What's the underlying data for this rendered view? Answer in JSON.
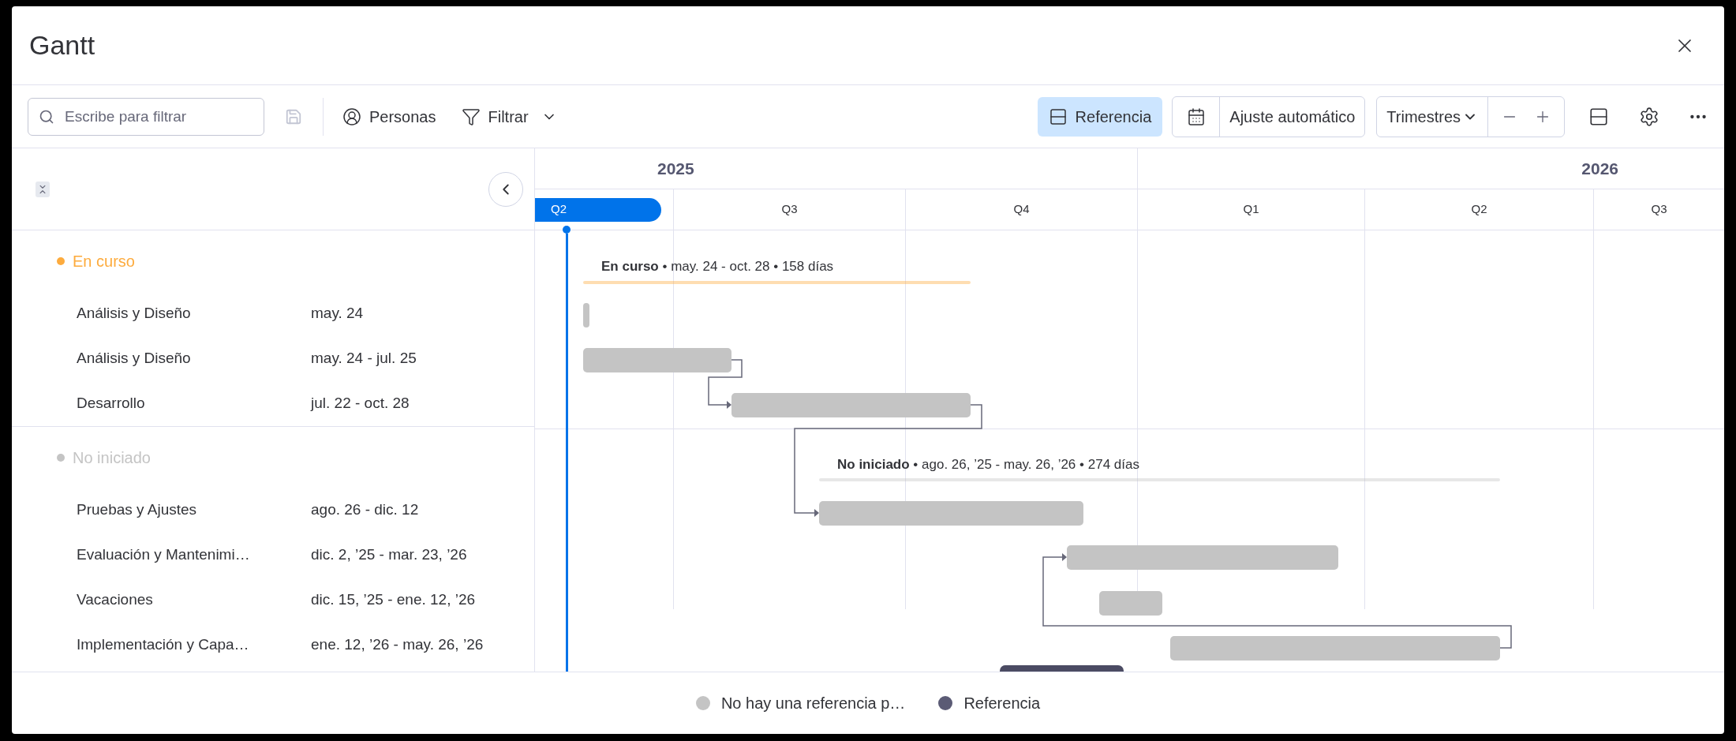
{
  "window": {
    "title": "Gantt"
  },
  "toolbar": {
    "search": {
      "placeholder": "Escribe para filtrar"
    },
    "people": "Personas",
    "filter": "Filtrar",
    "baseline": {
      "label": "Referencia",
      "selected": true
    },
    "auto_fit": "Ajuste automático",
    "scale": "Trimestres"
  },
  "timeline": {
    "years": [
      "2025",
      "2026"
    ],
    "quarters": [
      {
        "label": "Q2",
        "selected": true
      },
      {
        "label": "Q3",
        "selected": false
      },
      {
        "label": "Q4",
        "selected": false
      },
      {
        "label": "Q1",
        "selected": false
      },
      {
        "label": "Q2",
        "selected": false
      },
      {
        "label": "Q3",
        "selected": false
      }
    ]
  },
  "groups": [
    {
      "name": "En curso",
      "color": "#fdab3d",
      "summary": "**En curso** • may. 24 - oct. 28 • 158 días",
      "tasks": [
        {
          "name": "Análisis y Diseño",
          "dates": "may. 24"
        },
        {
          "name": "Análisis y Diseño",
          "dates": "may. 24 - jul. 25"
        },
        {
          "name": "Desarrollo",
          "dates": "jul. 22 - oct. 28"
        }
      ]
    },
    {
      "name": "No iniciado",
      "color": "#c4c4c4",
      "summary": "**No iniciado** • ago. 26, ’25 - may. 26, ’26 • 274 días",
      "tasks": [
        {
          "name": "Pruebas y Ajustes",
          "dates": "ago. 26 - dic. 12"
        },
        {
          "name": "Evaluación y Mantenimi…",
          "dates": "dic. 2, ’25 - mar. 23, ’26"
        },
        {
          "name": "Vacaciones",
          "dates": "dic. 15, ’25 - ene. 12, ’26"
        },
        {
          "name": "Implementación y Capa…",
          "dates": "ene. 12, ’26 - may. 26, ’26"
        }
      ]
    }
  ],
  "legend": [
    {
      "label": "No hay una referencia p…",
      "color": "#c4c4c4"
    },
    {
      "label": "Referencia",
      "color": "#5b5b75"
    }
  ]
}
